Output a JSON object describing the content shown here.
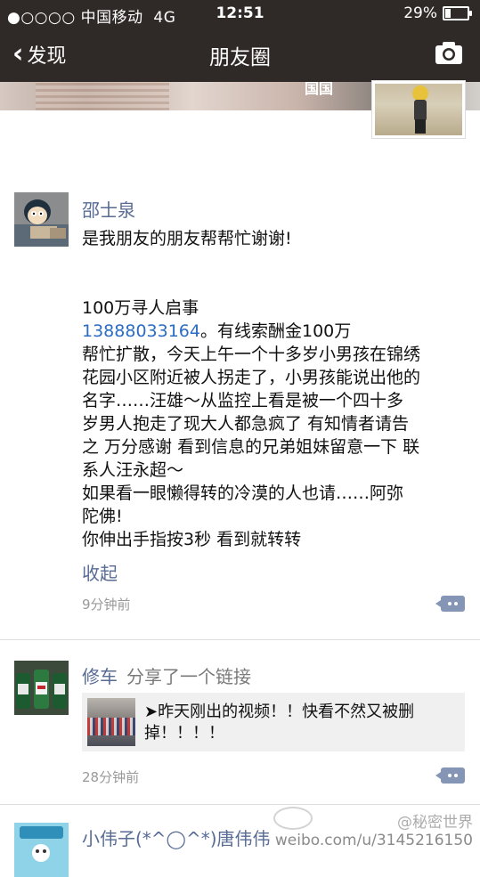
{
  "status_bar": {
    "carrier": "●○○○○ 中国移动",
    "network": "4G",
    "time": "12:51",
    "battery_percent": "29%",
    "battery_level": 0.29
  },
  "nav": {
    "back_label": "发现",
    "title": "朋友圈",
    "camera_icon": "camera-icon"
  },
  "cover": {
    "nickname": "国国"
  },
  "posts": [
    {
      "author": "邵士泉",
      "lines": [
        "是我朋友的朋友帮帮忙谢谢!",
        "",
        "",
        "100万寻人启事"
      ],
      "phone": "13888033164",
      "phone_suffix": "。有线索酬金100万",
      "more_lines": [
        "帮忙扩散，今天上午一个十多岁小男孩在锦绣",
        "花园小区附近被人拐走了，小男孩能说出他的",
        "名字……汪雄～从监控上看是被一个四十多",
        "岁男人抱走了现大人都急疯了 有知情者请告",
        "之 万分感谢 看到信息的兄弟姐妹留意一下 联",
        "系人汪永超～",
        "如果看一眼懒得转的冷漠的人也请……阿弥",
        "陀佛!",
        "你伸出手指按3秒 看到就转转"
      ],
      "collapse_label": "收起",
      "time_ago": "9分钟前"
    },
    {
      "author": "修车",
      "action": "分享了一个链接",
      "link_title_lines": [
        "➤昨天刚出的视频！！快看不然又被删",
        "掉！！！！"
      ],
      "time_ago": "28分钟前"
    },
    {
      "author": "小伟子(*^◯^*)唐伟伟"
    }
  ],
  "watermark": "weibo.com/u/3145216150",
  "watermark_name": "@秘密世界"
}
